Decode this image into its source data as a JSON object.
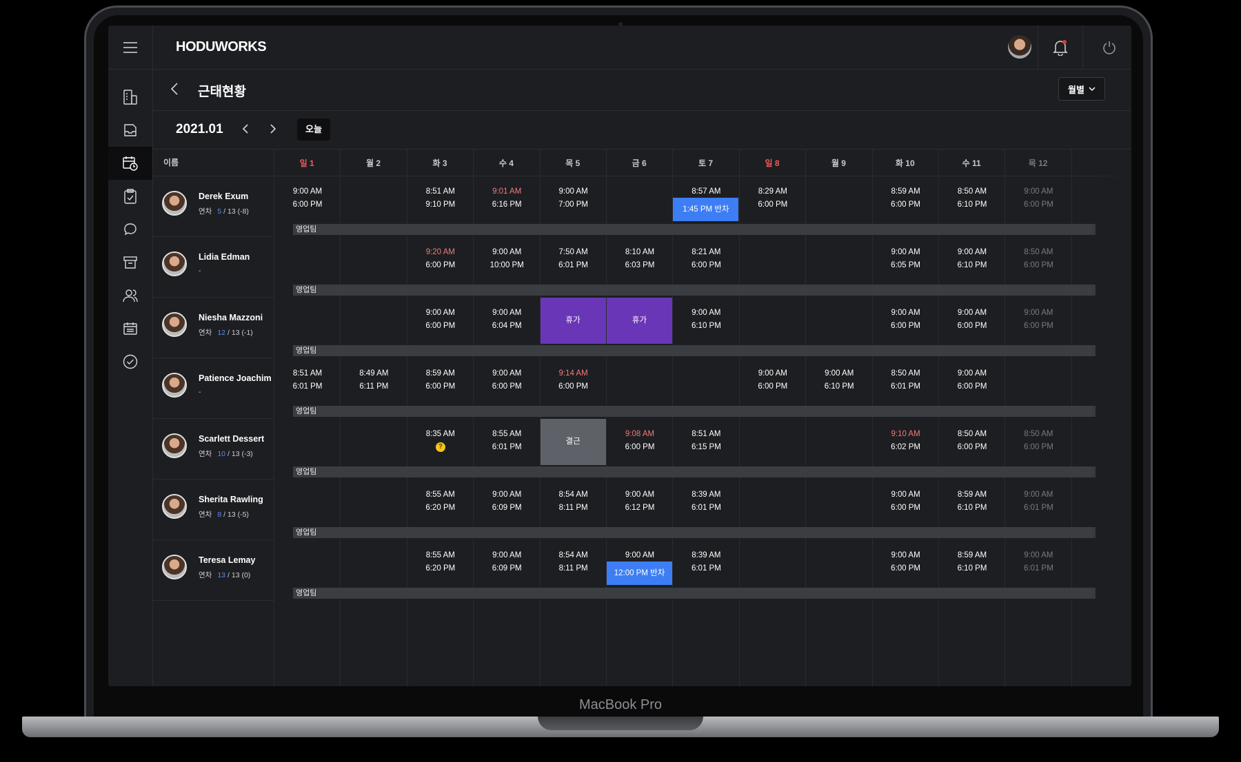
{
  "device_label": "MacBook Pro",
  "app": {
    "logo": "HODUWORKS"
  },
  "page": {
    "title": "근태현황",
    "view_select": "월별"
  },
  "toolbar": {
    "month": "2021.01",
    "today_label": "오늘"
  },
  "table": {
    "name_header": "이름",
    "days": [
      {
        "label": "일  1",
        "red": true
      },
      {
        "label": "월  2"
      },
      {
        "label": "화  3"
      },
      {
        "label": "수  4"
      },
      {
        "label": "목  5"
      },
      {
        "label": "금  6"
      },
      {
        "label": "토  7"
      },
      {
        "label": "일  8",
        "red": true
      },
      {
        "label": "월  9"
      },
      {
        "label": "화  10"
      },
      {
        "label": "수  11"
      },
      {
        "label": "목  12",
        "dim": true
      }
    ],
    "employees": [
      {
        "name": "Derek Exum",
        "leave_label": "연차",
        "leave_used": "5",
        "leave_rest": "/ 13 (-8)",
        "team": "영업팀",
        "cells": [
          [
            "9:00 AM",
            "6:00 PM"
          ],
          null,
          [
            "8:51 AM",
            "9:10 PM"
          ],
          [
            "9:01 AM",
            "6:16 PM",
            "late"
          ],
          [
            "9:00 AM",
            "7:00 PM"
          ],
          null,
          [
            "8:57 AM",
            "",
            "half",
            "1:45 PM 반차"
          ],
          [
            "8:29 AM",
            "6:00 PM"
          ],
          null,
          [
            "8:59 AM",
            "6:00 PM"
          ],
          [
            "8:50 AM",
            "6:10 PM"
          ],
          [
            "9:00 AM",
            "6:00 PM"
          ]
        ]
      },
      {
        "name": "Lidia Edman",
        "leave_label": "",
        "leave_used": "",
        "leave_rest": "-",
        "team": "영업팀",
        "cells": [
          null,
          null,
          [
            "9:20 AM",
            "6:00 PM",
            "late"
          ],
          [
            "9:00 AM",
            "10:00 PM"
          ],
          [
            "7:50 AM",
            "6:01 PM"
          ],
          [
            "8:10 AM",
            "6:03 PM"
          ],
          [
            "8:21 AM",
            "6:00 PM"
          ],
          null,
          null,
          [
            "9:00 AM",
            "6:05 PM"
          ],
          [
            "9:00 AM",
            "6:10 PM"
          ],
          [
            "8:50 AM",
            "6:00 PM"
          ]
        ]
      },
      {
        "name": "Niesha Mazzoni",
        "leave_label": "연차",
        "leave_used": "12",
        "leave_rest": "/ 13 (-1)",
        "team": "영업팀",
        "cells": [
          null,
          null,
          [
            "9:00 AM",
            "6:00 PM"
          ],
          [
            "9:00 AM",
            "6:04 PM"
          ],
          [
            "",
            "",
            "leave",
            "휴가"
          ],
          [
            "",
            "",
            "leave",
            "휴가"
          ],
          [
            "9:00 AM",
            "6:10 PM"
          ],
          null,
          null,
          [
            "9:00 AM",
            "6:00 PM"
          ],
          [
            "9:00 AM",
            "6:00 PM"
          ],
          [
            "9:00 AM",
            "6:00 PM"
          ]
        ]
      },
      {
        "name": "Patience Joachim",
        "leave_label": "",
        "leave_used": "",
        "leave_rest": "-",
        "team": "영업팀",
        "cells": [
          [
            "8:51 AM",
            "6:01 PM"
          ],
          [
            "8:49 AM",
            "6:11 PM"
          ],
          [
            "8:59 AM",
            "6:00 PM"
          ],
          [
            "9:00 AM",
            "6:00 PM"
          ],
          [
            "9:14 AM",
            "6:00 PM",
            "late"
          ],
          null,
          null,
          [
            "9:00 AM",
            "6:00 PM"
          ],
          [
            "9:00 AM",
            "6:10 PM"
          ],
          [
            "8:50 AM",
            "6:01 PM"
          ],
          [
            "9:00 AM",
            "6:00 PM"
          ],
          null
        ]
      },
      {
        "name": "Scarlett Dessert",
        "leave_label": "연차",
        "leave_used": "10",
        "leave_rest": "/ 13 (-3)",
        "team": "영업팀",
        "cells": [
          null,
          null,
          [
            "8:35 AM",
            "",
            "warn",
            "?"
          ],
          [
            "8:55 AM",
            "6:01 PM"
          ],
          [
            "",
            "",
            "absent",
            "결근"
          ],
          [
            "9:08 AM",
            "6:00 PM",
            "late"
          ],
          [
            "8:51 AM",
            "6:15 PM"
          ],
          null,
          null,
          [
            "9:10 AM",
            "6:02 PM",
            "late"
          ],
          [
            "8:50 AM",
            "6:00 PM"
          ],
          [
            "8:50 AM",
            "6:00 PM"
          ]
        ]
      },
      {
        "name": "Sherita Rawling",
        "leave_label": "연차",
        "leave_used": "8",
        "leave_rest": "/ 13 (-5)",
        "team": "영업팀",
        "cells": [
          null,
          null,
          [
            "8:55 AM",
            "6:20 PM"
          ],
          [
            "9:00 AM",
            "6:09 PM"
          ],
          [
            "8:54 AM",
            "8:11 PM"
          ],
          [
            "9:00 AM",
            "6:12 PM"
          ],
          [
            "8:39 AM",
            "6:01 PM"
          ],
          null,
          null,
          [
            "9:00 AM",
            "6:00 PM"
          ],
          [
            "8:59 AM",
            "6:10 PM"
          ],
          [
            "9:00 AM",
            "6:01 PM"
          ]
        ]
      },
      {
        "name": "Teresa Lemay",
        "leave_label": "연차",
        "leave_used": "13",
        "leave_rest": "/ 13 (0)",
        "team": "영업팀",
        "cells": [
          null,
          null,
          [
            "8:55 AM",
            "6:20 PM"
          ],
          [
            "9:00 AM",
            "6:09 PM"
          ],
          [
            "8:54 AM",
            "8:11 PM"
          ],
          [
            "9:00 AM",
            "",
            "half",
            "12:00 PM 반차"
          ],
          [
            "8:39 AM",
            "6:01 PM"
          ],
          null,
          null,
          [
            "9:00 AM",
            "6:00 PM"
          ],
          [
            "8:59 AM",
            "6:10 PM"
          ],
          [
            "9:00 AM",
            "6:01 PM"
          ]
        ]
      }
    ]
  },
  "icons": {
    "menu": "hamburger-icon",
    "bell": "bell-icon",
    "power": "power-icon",
    "sidebar": [
      "building-doc-icon",
      "inbox-icon",
      "calendar-clock-icon",
      "clipboard-check-icon",
      "chat-icon",
      "archive-icon",
      "people-icon",
      "id-card-icon",
      "check-circle-icon"
    ]
  },
  "colors": {
    "accent_blue": "#3d7ef5",
    "leave_purple": "#6a36b8",
    "absent_gray": "#5f6169",
    "late_red": "#f07a7a",
    "sunday_red": "#f05a5a"
  }
}
